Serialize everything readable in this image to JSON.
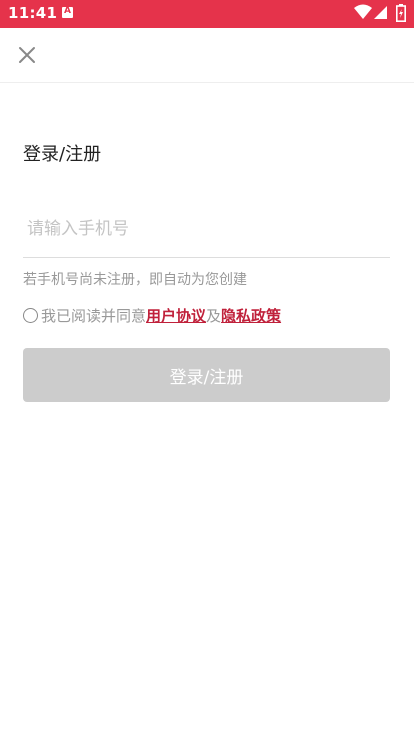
{
  "status_bar": {
    "time": "11:41",
    "notification_icon": "a-letter-icon",
    "icons": [
      "wifi-icon",
      "signal-icon",
      "battery-charging-icon"
    ],
    "background": "#e5334b"
  },
  "toolbar": {
    "close_icon": "close-icon"
  },
  "main": {
    "title": "登录/注册",
    "phone_placeholder": "请输入手机号",
    "hint": "若手机号尚未注册，即自动为您创建",
    "agreement": {
      "prefix": "我已阅读并同意",
      "user_agreement": "用户协议",
      "connector": "及",
      "privacy_policy": "隐私政策"
    },
    "login_button": "登录/注册"
  },
  "colors": {
    "accent": "#c0213b",
    "button_disabled": "#cccccc"
  }
}
